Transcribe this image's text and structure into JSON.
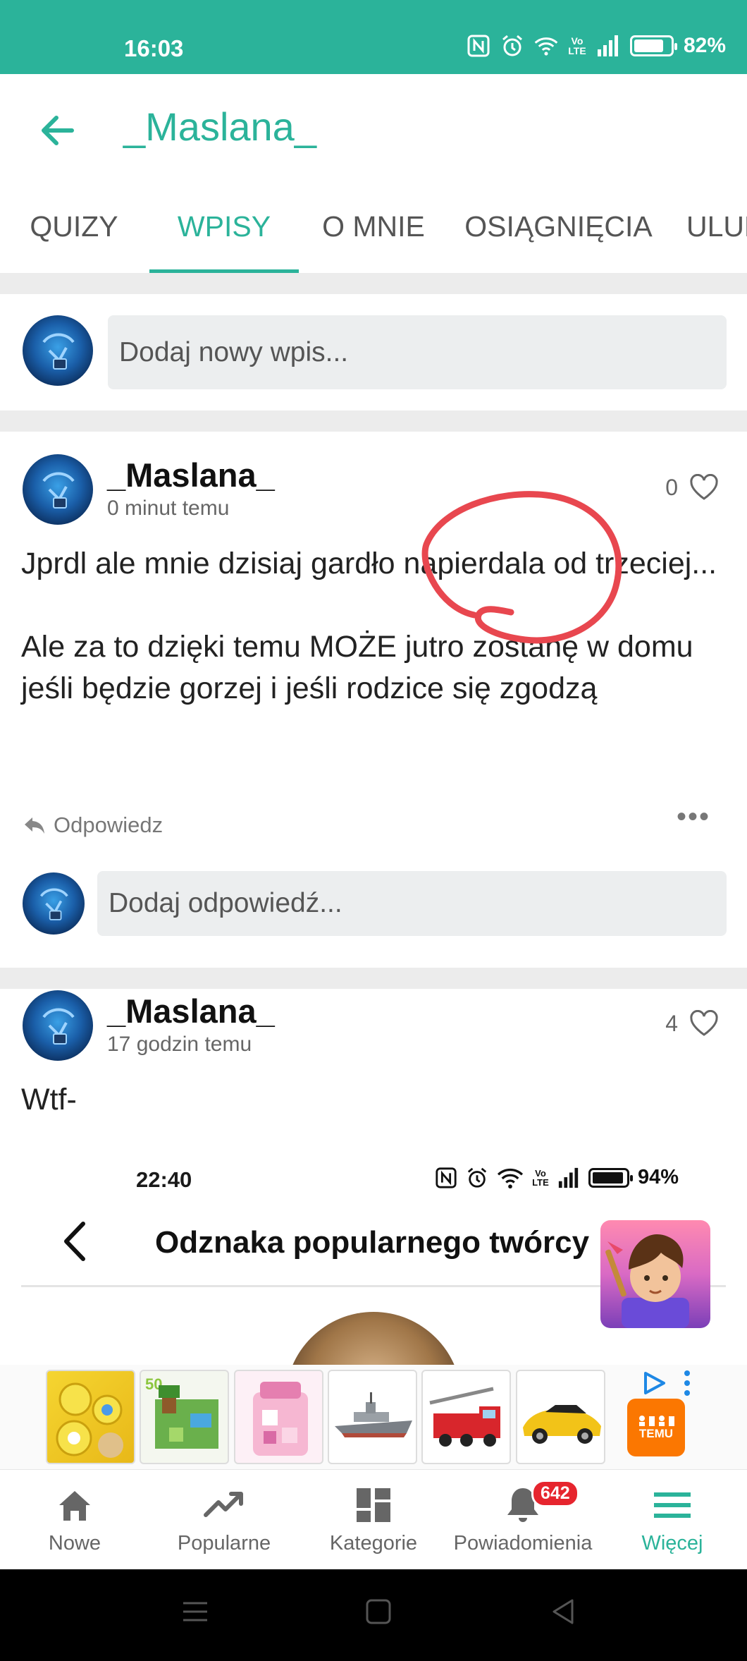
{
  "status_bar": {
    "time": "16:03",
    "battery": "82%",
    "battery_level": 0.82,
    "network": "Vo LTE"
  },
  "header": {
    "title": "_Maslana_"
  },
  "tabs": [
    {
      "label": "QUIZY",
      "active": false
    },
    {
      "label": "WPISY",
      "active": true
    },
    {
      "label": "O MNIE",
      "active": false
    },
    {
      "label": "OSIĄGNIĘCIA",
      "active": false
    },
    {
      "label": "ULUBIONE",
      "active": false
    }
  ],
  "compose": {
    "placeholder": "Dodaj nowy wpis..."
  },
  "posts": [
    {
      "author": "_Maslana_",
      "time": "0 minut temu",
      "likes": "0",
      "body": "Jprdl ale mnie dzisiaj gardło napierdala od trzeciej...\n\nAle za to dzięki temu MOŻE jutro zostanę w domu jeśli będzie gorzej i jeśli rodzice się zgodzą",
      "reply_label": "Odpowiedz",
      "reply_placeholder": "Dodaj odpowiedź..."
    },
    {
      "author": "_Maslana_",
      "time": "17 godzin temu",
      "likes": "4",
      "body": "Wtf-"
    }
  ],
  "embedded_screenshot": {
    "time": "22:40",
    "battery": "94%",
    "battery_level": 0.94,
    "network": "Vo LTE",
    "title": "Odznaka popularnego twórcy"
  },
  "ad": {
    "brand": "TEMU",
    "items": [
      "ad-toy-balls",
      "ad-block-garden",
      "ad-pink-box",
      "ad-battleship",
      "ad-fire-truck",
      "ad-race-car"
    ]
  },
  "bottom_nav": [
    {
      "label": "Nowe",
      "icon": "home-icon",
      "active": false
    },
    {
      "label": "Popularne",
      "icon": "trending-icon",
      "active": false
    },
    {
      "label": "Kategorie",
      "icon": "grid-icon",
      "active": false
    },
    {
      "label": "Powiadomienia",
      "icon": "bell-icon",
      "active": false,
      "badge": "642"
    },
    {
      "label": "Więcej",
      "icon": "menu-icon",
      "active": true
    }
  ],
  "colors": {
    "accent": "#2bb39a",
    "badge": "#e6252e",
    "annotation": "#e8474f",
    "temu": "#fb7701"
  }
}
